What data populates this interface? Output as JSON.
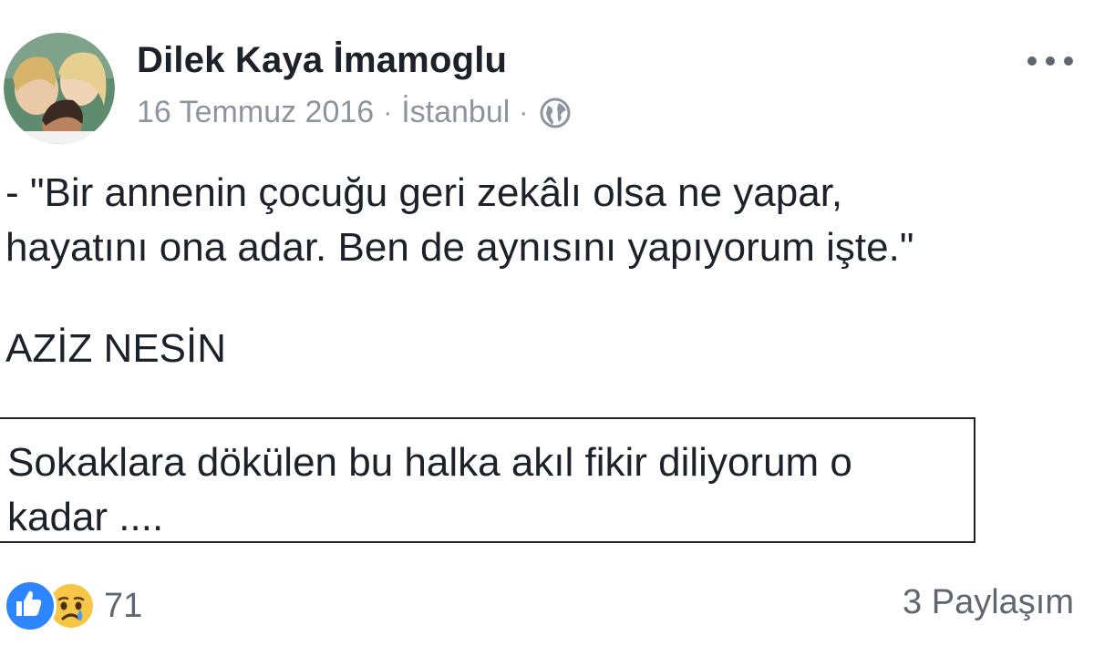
{
  "post": {
    "author_name": "Dilek Kaya İmamoglu",
    "date": "16 Temmuz 2016",
    "location": "İstanbul",
    "separator": "·",
    "privacy_icon": "globe-icon",
    "more_icon": "more-options-icon",
    "body_lines": [
      "- \"Bir annenin çocuğu geri zekâlı olsa ne yapar,",
      "hayatını ona adar. Ben de aynısını yapıyorum işte.\""
    ],
    "signature": "AZİZ NESİN",
    "quote_lines": [
      "Sokaklara dökülen bu halka akıl fikir diliyorum o",
      "kadar ...."
    ]
  },
  "footer": {
    "reaction_icons": [
      "like-icon",
      "sad-icon"
    ],
    "reaction_count": "71",
    "shares": "3 Paylaşım"
  },
  "colors": {
    "text": "#1d2129",
    "meta": "#8d949e",
    "like_blue": "#2d86ff",
    "sad_yellow": "#f7c646"
  }
}
